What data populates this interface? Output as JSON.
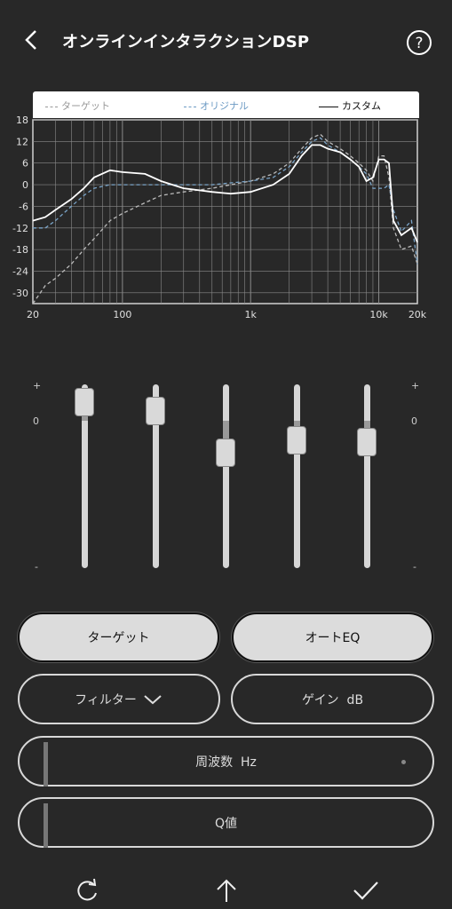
{
  "header": {
    "title": "オンラインインタラクションDSP"
  },
  "legend": {
    "target": "ターゲット",
    "original": "オリジナル",
    "custom": "カスタム"
  },
  "chart_data": {
    "type": "line",
    "x_scale": "log",
    "xlim": [
      20,
      20000
    ],
    "ylim": [
      -33,
      18
    ],
    "x_ticks": [
      "20",
      "100",
      "1k",
      "10k",
      "20k"
    ],
    "y_ticks": [
      "18",
      "12",
      "6",
      "0",
      "-6",
      "-12",
      "-18",
      "-24",
      "-30"
    ],
    "grid": true,
    "series": [
      {
        "name": "ターゲット",
        "style": "dashed",
        "color": "#bbbbbb",
        "x": [
          20,
          25,
          30,
          40,
          50,
          60,
          80,
          100,
          150,
          200,
          300,
          500,
          700,
          1000,
          1500,
          2000,
          2500,
          3000,
          3500,
          4000,
          5000,
          6000,
          7000,
          8000,
          9000,
          10000,
          11000,
          12000,
          13000,
          15000,
          18000,
          20000
        ],
        "y": [
          -33,
          -28,
          -26,
          -22,
          -18,
          -15,
          -10,
          -8,
          -5,
          -3,
          -2,
          -1,
          0,
          1,
          3,
          6,
          10,
          13,
          14,
          12,
          10,
          8,
          6,
          4,
          1,
          8,
          8,
          2,
          -12,
          -18,
          -17,
          -22
        ]
      },
      {
        "name": "オリジナル",
        "style": "dashed",
        "color": "#7aa4c8",
        "x": [
          20,
          25,
          30,
          40,
          50,
          60,
          80,
          100,
          150,
          200,
          300,
          500,
          700,
          1000,
          1500,
          2000,
          2500,
          3000,
          3500,
          4000,
          5000,
          6000,
          7000,
          8000,
          9000,
          10000,
          11000,
          12000,
          13000,
          15000,
          18000,
          20000
        ],
        "y": [
          -12,
          -12,
          -10,
          -6,
          -3,
          -1,
          0,
          0,
          0,
          0,
          0,
          0,
          0.5,
          1,
          2,
          5,
          9,
          12,
          13,
          11,
          9,
          7,
          5,
          3,
          -1,
          -1,
          -1,
          0,
          -7,
          -13,
          -10,
          -22
        ]
      },
      {
        "name": "カスタム",
        "style": "solid",
        "color": "#ffffff",
        "x": [
          20,
          25,
          30,
          40,
          50,
          60,
          80,
          100,
          150,
          200,
          300,
          500,
          700,
          1000,
          1500,
          2000,
          2500,
          3000,
          3500,
          4000,
          5000,
          6000,
          7000,
          8000,
          9000,
          10000,
          11000,
          12000,
          13000,
          15000,
          18000,
          20000
        ],
        "y": [
          -10,
          -9,
          -7,
          -4,
          -1,
          2,
          4,
          3.5,
          3,
          1,
          -1,
          -2,
          -2.5,
          -2,
          0,
          3,
          8,
          11,
          11,
          10,
          9,
          7,
          5,
          1,
          2,
          7,
          7,
          6,
          -10,
          -14,
          -12,
          -16
        ]
      }
    ]
  },
  "eq_scale": {
    "plus": "+",
    "zero": "0",
    "minus": "-"
  },
  "sliders": [
    {
      "value": 0.98
    },
    {
      "value": 0.92
    },
    {
      "value": 0.65
    },
    {
      "value": 0.73
    },
    {
      "value": 0.72
    }
  ],
  "buttons": {
    "target": "ターゲット",
    "auto_eq": "オートEQ",
    "filter": "フィルター",
    "gain": "ゲイン  dB",
    "frequency": "周波数  Hz",
    "q_value": "Q値"
  },
  "bottom_nav": {
    "reset": "reset-icon",
    "upload": "upload-icon",
    "confirm": "check-icon"
  }
}
